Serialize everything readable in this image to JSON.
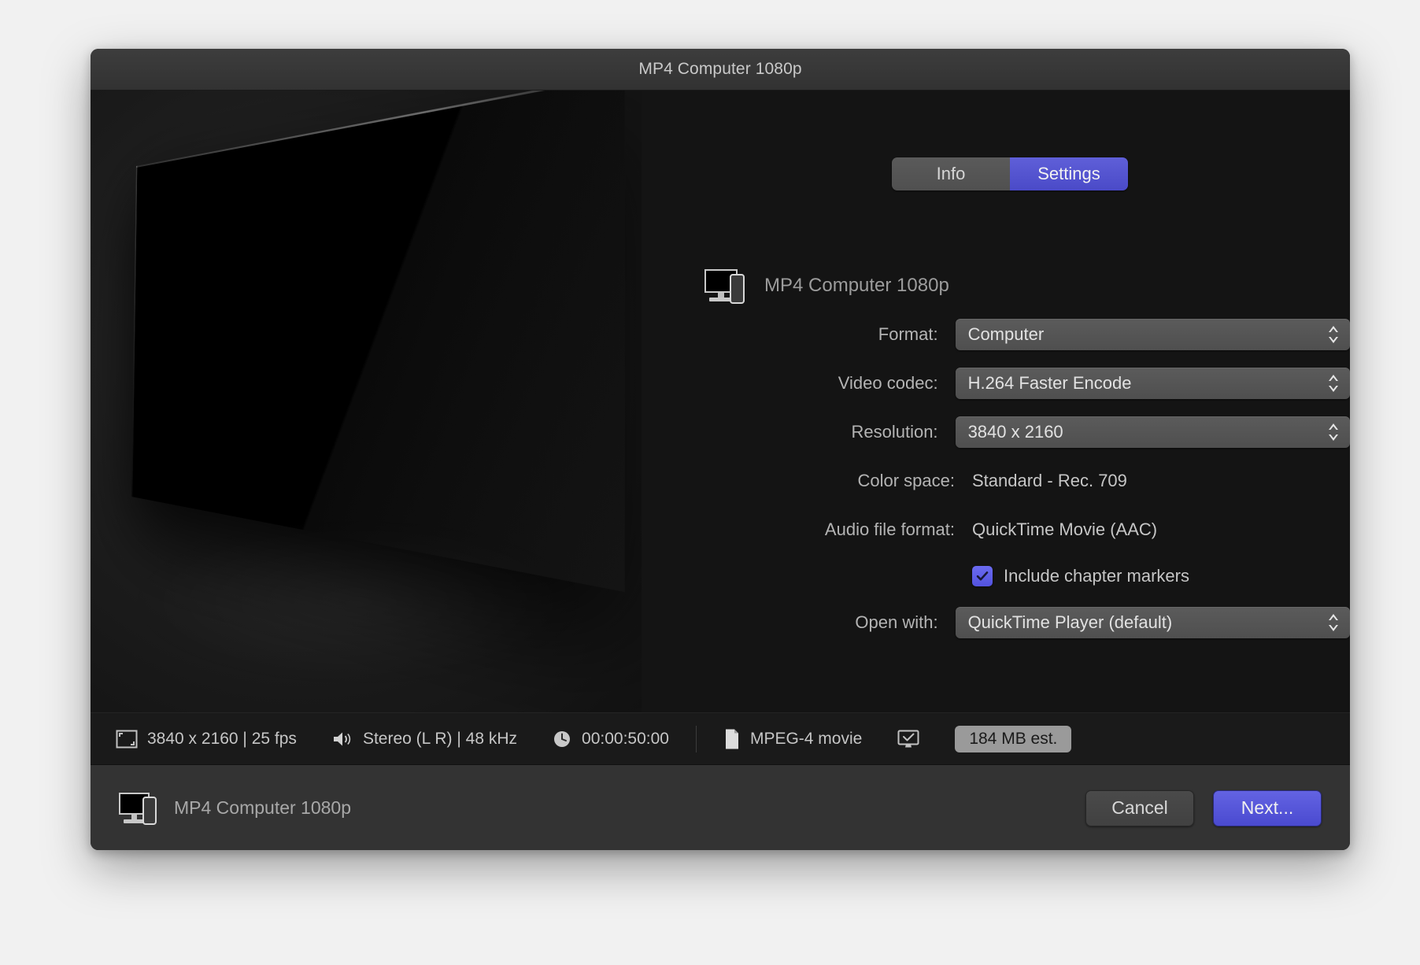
{
  "window": {
    "title": "MP4 Computer 1080p"
  },
  "tabs": [
    {
      "label": "Info",
      "selected": false
    },
    {
      "label": "Settings",
      "selected": true
    }
  ],
  "preset": {
    "name": "MP4 Computer 1080p",
    "icon": "computer-phone-icon"
  },
  "form": {
    "rows": [
      {
        "label": "Format:",
        "value": "Computer",
        "type": "popup"
      },
      {
        "label": "Video codec:",
        "value": "H.264 Faster Encode",
        "type": "popup"
      },
      {
        "label": "Resolution:",
        "value": "3840 x 2160",
        "type": "popup"
      },
      {
        "label": "Color space:",
        "value": "Standard - Rec. 709",
        "type": "static"
      },
      {
        "label": "Audio file format:",
        "value": "QuickTime Movie (AAC)",
        "type": "static"
      },
      {
        "label": "",
        "value": "Include chapter markers",
        "type": "checkbox",
        "checked": true
      },
      {
        "label": "Open with:",
        "value": "QuickTime Player (default)",
        "type": "popup"
      }
    ]
  },
  "status": {
    "resolution": "3840 x 2160 | 25 fps",
    "audio": "Stereo (L R) | 48 kHz",
    "duration": "00:00:50:00",
    "filetype": "MPEG-4 movie",
    "size_estimate": "184 MB est.",
    "icons": {
      "resolution": "frame-icon",
      "audio": "speaker-icon",
      "duration": "clock-icon",
      "filetype": "document-icon",
      "destination": "monitor-check-icon"
    }
  },
  "footer": {
    "preset_name": "MP4 Computer 1080p",
    "cancel_label": "Cancel",
    "next_label": "Next..."
  },
  "colors": {
    "accent": "#5353e0",
    "tab_selected": "#4a4ac8",
    "window_bg": "#1e1e1e",
    "titlebar": "#373737",
    "footer": "#333333",
    "badge": "#9a9a9a"
  }
}
